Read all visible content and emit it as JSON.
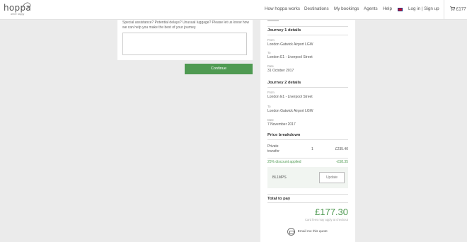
{
  "header": {
    "logo_text": "hoppa",
    "logo_tagline": "arrive happy",
    "nav": {
      "how_it_works": "How hoppa works",
      "destinations": "Destinations",
      "bookings": "My bookings",
      "agents": "Agents",
      "help": "Help",
      "login": "Log in | Sign up"
    },
    "cart_label": "£177"
  },
  "form": {
    "hint": "Special assistance? Potential delays? Unusual luggage? Please let us know how we can help you make the best of your journey.",
    "notes_value": "",
    "continue_label": "Continue"
  },
  "summary": {
    "journey1": {
      "title": "Journey 1 details",
      "from_label": "From",
      "from_value": "London Gatwick Airport LGW",
      "to_label": "To",
      "to_value": "London E1 - Liverpool Street",
      "date_label": "Date",
      "date_value": "31 October 2017"
    },
    "journey2": {
      "title": "Journey 2 details",
      "from_label": "From",
      "from_value": "London E1 - Liverpool Street",
      "to_label": "To",
      "to_value": "London Gatwick Airport LGW",
      "date_label": "Date",
      "date_value": "7 November 2017"
    },
    "price": {
      "title": "Price breakdown",
      "item_label_line1": "Private",
      "item_label_line2": "transfer",
      "item_qty": "1",
      "item_amount": "£235.40",
      "discount_label": "25% discount applied",
      "discount_amount": "-£58.35",
      "promo_code": "BL1MPS",
      "update_label": "Update"
    },
    "total": {
      "title": "Total to pay",
      "amount": "£177.30",
      "card_fee": "Card fees may apply at checkout"
    },
    "email_quote_label": "Email me this quote"
  },
  "colors": {
    "accent_green": "#4f9a52",
    "page_bg": "#ebebeb"
  }
}
